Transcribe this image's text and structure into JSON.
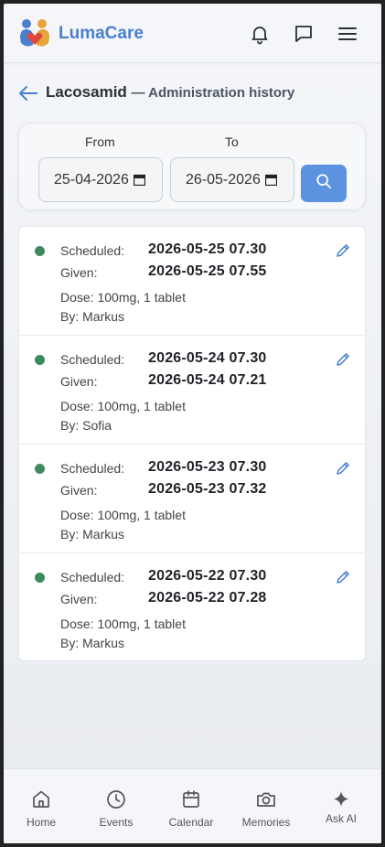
{
  "app": {
    "name": "LumaCare"
  },
  "page": {
    "medication": "Lacosamid",
    "subtitle": "— Administration history"
  },
  "filter": {
    "from_label": "From",
    "to_label": "To",
    "from_value": "25-04-2026",
    "to_value": "26-05-2026"
  },
  "entries": [
    {
      "scheduled_label": "Scheduled:",
      "scheduled": "2026-05-25 07.30",
      "given_label": "Given:",
      "given": "2026-05-25 07.55",
      "dose": "Dose: 100mg, 1 tablet",
      "by": "By: Markus",
      "status_color": "#3f8a5c"
    },
    {
      "scheduled_label": "Scheduled:",
      "scheduled": "2026-05-24 07.30",
      "given_label": "Given:",
      "given": "2026-05-24 07.21",
      "dose": "Dose: 100mg, 1 tablet",
      "by": "By: Sofia",
      "status_color": "#3f8a5c"
    },
    {
      "scheduled_label": "Scheduled:",
      "scheduled": "2026-05-23 07.30",
      "given_label": "Given:",
      "given": "2026-05-23 07.32",
      "dose": "Dose: 100mg, 1 tablet",
      "by": "By: Markus",
      "status_color": "#3f8a5c"
    },
    {
      "scheduled_label": "Scheduled:",
      "scheduled": "2026-05-22 07.30",
      "given_label": "Given:",
      "given": "2026-05-22 07.28",
      "dose": "Dose: 100mg, 1 tablet",
      "by": "By: Markus",
      "status_color": "#3f8a5c"
    }
  ],
  "nav": {
    "home": "Home",
    "events": "Events",
    "calendar": "Calendar",
    "memories": "Memories",
    "ask_ai": "Ask AI"
  },
  "icons": {
    "notifications": "bell-icon",
    "messages": "chat-icon",
    "menu": "hamburger-icon",
    "back": "arrow-left-icon",
    "search": "search-icon",
    "edit": "pencil-icon"
  },
  "colors": {
    "accent": "#4a7fd0",
    "button": "#5b93e0",
    "given_status": "#3f8a5c"
  }
}
